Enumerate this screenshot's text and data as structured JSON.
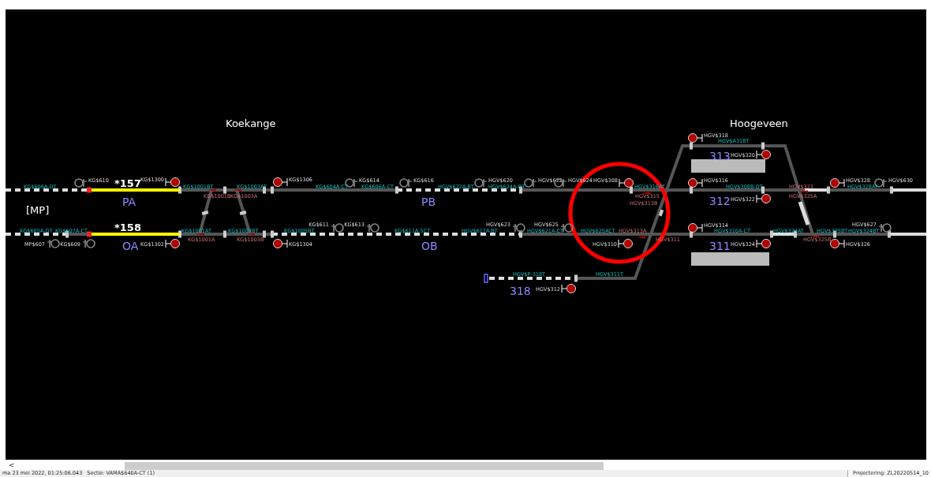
{
  "stations": [
    {
      "name": "Koekange"
    },
    {
      "name": "Hoogeveen"
    }
  ],
  "area_label": "[MP]",
  "trains": [
    {
      "number": "*157",
      "occupied": true
    },
    {
      "number": "*158",
      "occupied": true
    }
  ],
  "track_names": [
    "PA",
    "OA",
    "PB",
    "OB",
    "313",
    "312",
    "311",
    "318"
  ],
  "signals": [
    {
      "label": "KG$1300"
    },
    {
      "label": "KG$1302"
    },
    {
      "label": "KG$1306"
    },
    {
      "label": "KG$1304"
    },
    {
      "label": "HGV$308"
    },
    {
      "label": "HGV$310"
    },
    {
      "label": "HGV$312"
    },
    {
      "label": "HGV$318"
    },
    {
      "label": "HGV$320"
    },
    {
      "label": "HGV$316"
    },
    {
      "label": "HGV$322"
    },
    {
      "label": "HGV$314"
    },
    {
      "label": "HGV$324"
    },
    {
      "label": "HGV$328"
    },
    {
      "label": "HGV$326"
    }
  ],
  "markers": [
    {
      "label": "KG$610"
    },
    {
      "label": "KG$614"
    },
    {
      "label": "KG$616"
    },
    {
      "label": "HGV$620"
    },
    {
      "label": "HGV$622"
    },
    {
      "label": "HGV$624"
    },
    {
      "label": "HGV$630"
    },
    {
      "label": "MP$607"
    },
    {
      "label": "KG$609"
    },
    {
      "label": "KG$611"
    },
    {
      "label": "KG$613"
    },
    {
      "label": "HGV$623"
    },
    {
      "label": "HGV$625"
    },
    {
      "label": "HGV$627"
    }
  ],
  "section_labels": [
    "KG$606A-DT",
    "KG$605A-DT",
    "KG$1001BT",
    "KG$1003AT",
    "KG$604A-CT",
    "KG$606A-CT",
    "HGV$622A-BT",
    "HGV$624A-DT",
    "HGV$316AT",
    "KG$607A-CT",
    "KG$1001AT",
    "KG$1003BT",
    "KG$1005BT",
    "KG$611A-5CT",
    "HGV$617A-BT",
    "HGV$621A-CT",
    "HGV$625ACT",
    "HGV$P-318T",
    "HGV$311T",
    "HGV$A318T",
    "HGV$308B-DT",
    "HGV$310A-CT",
    "HGV$324AT",
    "HGV$328AT",
    "HGV$325BT",
    "HGV$324BT"
  ],
  "switch_labels": [
    "KG$1001B",
    "KG$1003A",
    "KG$1001A",
    "KG$1003B",
    "HGV$315",
    "HGV$313B",
    "HGV$313A",
    "HGV$311",
    "HGV$323",
    "HGV$325A",
    "HGV$325B"
  ],
  "scrollbar": {
    "left_button": "<"
  },
  "status_bar": {
    "timestamp": "ma 23 mei 2022, 01:25:06.043",
    "section": "Sectie: VAMA$640A-CT (1)",
    "project": "Projectering: ZL20220514_10"
  }
}
